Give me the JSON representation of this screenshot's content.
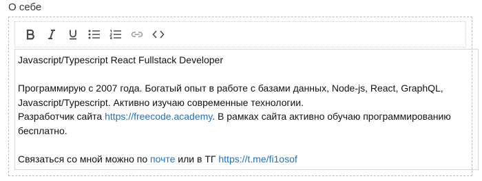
{
  "field": {
    "label": "О себе"
  },
  "toolbar": {
    "buttons": [
      {
        "icon": "bold-icon",
        "name": "bold-button"
      },
      {
        "icon": "italic-icon",
        "name": "italic-button"
      },
      {
        "icon": "underline-icon",
        "name": "underline-button"
      },
      {
        "icon": "bulleted-list-icon",
        "name": "bulleted-list-button"
      },
      {
        "icon": "numbered-list-icon",
        "name": "numbered-list-button"
      },
      {
        "icon": "link-icon",
        "name": "link-button"
      },
      {
        "icon": "code-icon",
        "name": "code-button"
      }
    ]
  },
  "content": {
    "heading": "Javascript/Typescript React Fullstack Developer",
    "p1": "Программирую с 2007 года. Богатый опыт в работе с базами данных, Node-js, React, GraphQL, Javascript/Typescript. Активно изучаю современные технологии.",
    "p2_before": "Разработчик сайта ",
    "p2_link": "https://freecode.academy",
    "p2_after": ". В рамках сайта активно обучаю программированию бесплатно.",
    "p3_before": "Связаться со мной можно по ",
    "p3_link1": "почте",
    "p3_middle": " или в ТГ ",
    "p3_link2": "https://t.me/fi1osof"
  },
  "colors": {
    "link": "#1a73c8",
    "toolbar_icon": "#4a4a4a",
    "border": "#bdbdbd"
  }
}
